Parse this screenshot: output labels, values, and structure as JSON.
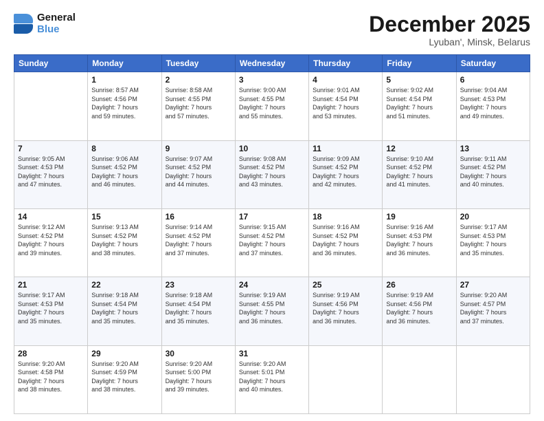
{
  "header": {
    "logo_line1": "General",
    "logo_line2": "Blue",
    "month_title": "December 2025",
    "location": "Lyuban', Minsk, Belarus"
  },
  "days_of_week": [
    "Sunday",
    "Monday",
    "Tuesday",
    "Wednesday",
    "Thursday",
    "Friday",
    "Saturday"
  ],
  "weeks": [
    [
      {
        "day": "",
        "info": ""
      },
      {
        "day": "1",
        "info": "Sunrise: 8:57 AM\nSunset: 4:56 PM\nDaylight: 7 hours\nand 59 minutes."
      },
      {
        "day": "2",
        "info": "Sunrise: 8:58 AM\nSunset: 4:55 PM\nDaylight: 7 hours\nand 57 minutes."
      },
      {
        "day": "3",
        "info": "Sunrise: 9:00 AM\nSunset: 4:55 PM\nDaylight: 7 hours\nand 55 minutes."
      },
      {
        "day": "4",
        "info": "Sunrise: 9:01 AM\nSunset: 4:54 PM\nDaylight: 7 hours\nand 53 minutes."
      },
      {
        "day": "5",
        "info": "Sunrise: 9:02 AM\nSunset: 4:54 PM\nDaylight: 7 hours\nand 51 minutes."
      },
      {
        "day": "6",
        "info": "Sunrise: 9:04 AM\nSunset: 4:53 PM\nDaylight: 7 hours\nand 49 minutes."
      }
    ],
    [
      {
        "day": "7",
        "info": "Sunrise: 9:05 AM\nSunset: 4:53 PM\nDaylight: 7 hours\nand 47 minutes."
      },
      {
        "day": "8",
        "info": "Sunrise: 9:06 AM\nSunset: 4:52 PM\nDaylight: 7 hours\nand 46 minutes."
      },
      {
        "day": "9",
        "info": "Sunrise: 9:07 AM\nSunset: 4:52 PM\nDaylight: 7 hours\nand 44 minutes."
      },
      {
        "day": "10",
        "info": "Sunrise: 9:08 AM\nSunset: 4:52 PM\nDaylight: 7 hours\nand 43 minutes."
      },
      {
        "day": "11",
        "info": "Sunrise: 9:09 AM\nSunset: 4:52 PM\nDaylight: 7 hours\nand 42 minutes."
      },
      {
        "day": "12",
        "info": "Sunrise: 9:10 AM\nSunset: 4:52 PM\nDaylight: 7 hours\nand 41 minutes."
      },
      {
        "day": "13",
        "info": "Sunrise: 9:11 AM\nSunset: 4:52 PM\nDaylight: 7 hours\nand 40 minutes."
      }
    ],
    [
      {
        "day": "14",
        "info": "Sunrise: 9:12 AM\nSunset: 4:52 PM\nDaylight: 7 hours\nand 39 minutes."
      },
      {
        "day": "15",
        "info": "Sunrise: 9:13 AM\nSunset: 4:52 PM\nDaylight: 7 hours\nand 38 minutes."
      },
      {
        "day": "16",
        "info": "Sunrise: 9:14 AM\nSunset: 4:52 PM\nDaylight: 7 hours\nand 37 minutes."
      },
      {
        "day": "17",
        "info": "Sunrise: 9:15 AM\nSunset: 4:52 PM\nDaylight: 7 hours\nand 37 minutes."
      },
      {
        "day": "18",
        "info": "Sunrise: 9:16 AM\nSunset: 4:52 PM\nDaylight: 7 hours\nand 36 minutes."
      },
      {
        "day": "19",
        "info": "Sunrise: 9:16 AM\nSunset: 4:53 PM\nDaylight: 7 hours\nand 36 minutes."
      },
      {
        "day": "20",
        "info": "Sunrise: 9:17 AM\nSunset: 4:53 PM\nDaylight: 7 hours\nand 35 minutes."
      }
    ],
    [
      {
        "day": "21",
        "info": "Sunrise: 9:17 AM\nSunset: 4:53 PM\nDaylight: 7 hours\nand 35 minutes."
      },
      {
        "day": "22",
        "info": "Sunrise: 9:18 AM\nSunset: 4:54 PM\nDaylight: 7 hours\nand 35 minutes."
      },
      {
        "day": "23",
        "info": "Sunrise: 9:18 AM\nSunset: 4:54 PM\nDaylight: 7 hours\nand 35 minutes."
      },
      {
        "day": "24",
        "info": "Sunrise: 9:19 AM\nSunset: 4:55 PM\nDaylight: 7 hours\nand 36 minutes."
      },
      {
        "day": "25",
        "info": "Sunrise: 9:19 AM\nSunset: 4:56 PM\nDaylight: 7 hours\nand 36 minutes."
      },
      {
        "day": "26",
        "info": "Sunrise: 9:19 AM\nSunset: 4:56 PM\nDaylight: 7 hours\nand 36 minutes."
      },
      {
        "day": "27",
        "info": "Sunrise: 9:20 AM\nSunset: 4:57 PM\nDaylight: 7 hours\nand 37 minutes."
      }
    ],
    [
      {
        "day": "28",
        "info": "Sunrise: 9:20 AM\nSunset: 4:58 PM\nDaylight: 7 hours\nand 38 minutes."
      },
      {
        "day": "29",
        "info": "Sunrise: 9:20 AM\nSunset: 4:59 PM\nDaylight: 7 hours\nand 38 minutes."
      },
      {
        "day": "30",
        "info": "Sunrise: 9:20 AM\nSunset: 5:00 PM\nDaylight: 7 hours\nand 39 minutes."
      },
      {
        "day": "31",
        "info": "Sunrise: 9:20 AM\nSunset: 5:01 PM\nDaylight: 7 hours\nand 40 minutes."
      },
      {
        "day": "",
        "info": ""
      },
      {
        "day": "",
        "info": ""
      },
      {
        "day": "",
        "info": ""
      }
    ]
  ]
}
